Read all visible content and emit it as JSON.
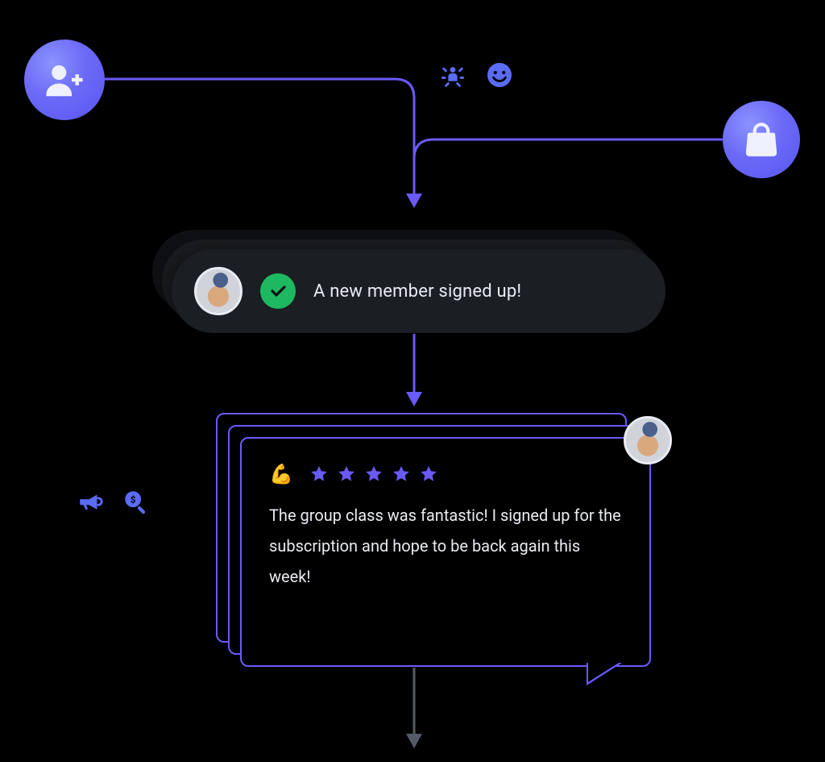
{
  "colors": {
    "accent": "#6a5af9",
    "success": "#1db860",
    "icon": "#5a6cf3",
    "text": "#e9ebf2",
    "card_bg": "#1b1e22"
  },
  "icons_top": {
    "left": "user-add",
    "right": "shopping-bag",
    "floating": [
      "sparkle-person",
      "smile-face"
    ]
  },
  "notification": {
    "text": "A new member signed up!",
    "status": "success"
  },
  "review": {
    "emoji": "💪",
    "stars": 5,
    "text": "The group class was fantastic! I signed up for the subscription and hope to be back again this week!"
  },
  "side_icons": [
    "megaphone",
    "search-dollar"
  ]
}
